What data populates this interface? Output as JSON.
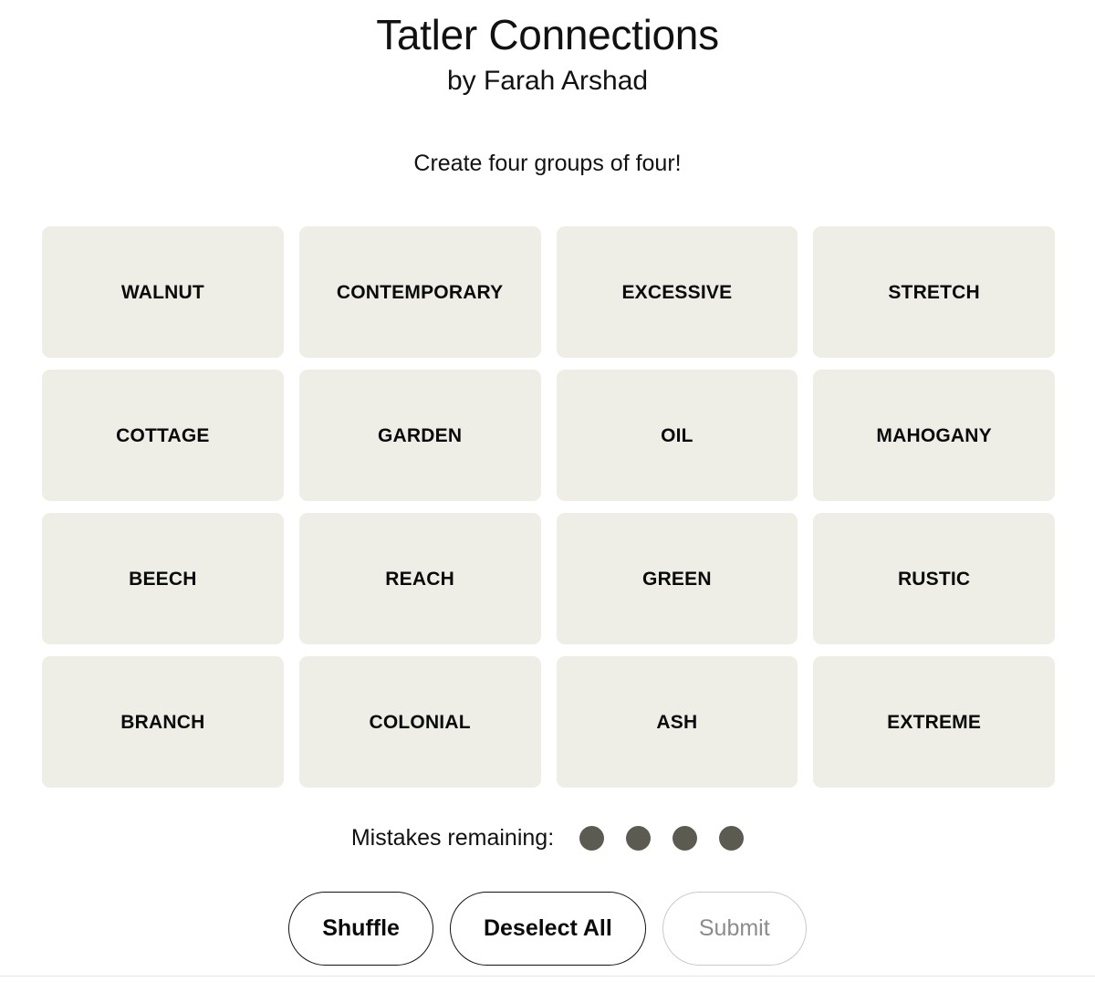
{
  "header": {
    "title": "Tatler Connections",
    "author": "by Farah Arshad",
    "instructions": "Create four groups of four!"
  },
  "board": {
    "tiles": [
      {
        "label": "WALNUT"
      },
      {
        "label": "CONTEMPORARY"
      },
      {
        "label": "EXCESSIVE"
      },
      {
        "label": "STRETCH"
      },
      {
        "label": "COTTAGE"
      },
      {
        "label": "GARDEN"
      },
      {
        "label": "OIL"
      },
      {
        "label": "MAHOGANY"
      },
      {
        "label": "BEECH"
      },
      {
        "label": "REACH"
      },
      {
        "label": "GREEN"
      },
      {
        "label": "RUSTIC"
      },
      {
        "label": "BRANCH"
      },
      {
        "label": "COLONIAL"
      },
      {
        "label": "ASH"
      },
      {
        "label": "EXTREME"
      }
    ],
    "tile_background": "#EEEEE6",
    "tile_text_color": "#0A0A0A"
  },
  "mistakes": {
    "label": "Mistakes remaining:",
    "remaining": 4,
    "dot_color": "#5B5B51"
  },
  "actions": {
    "shuffle_label": "Shuffle",
    "deselect_label": "Deselect All",
    "submit_label": "Submit",
    "submit_disabled": true,
    "enabled_border_color": "#111111",
    "disabled_border_color": "#C9C9C9",
    "disabled_text_color": "#8C8C8C"
  }
}
